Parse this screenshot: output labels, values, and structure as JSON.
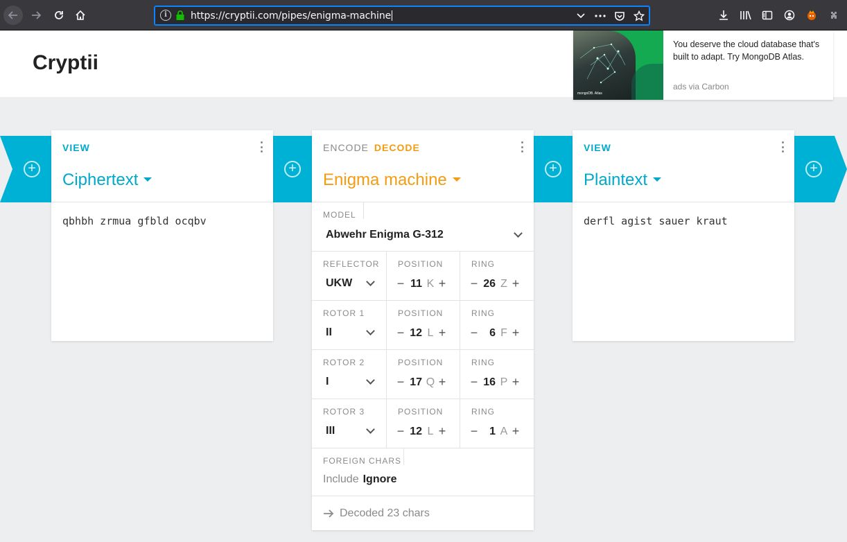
{
  "browser": {
    "url": "https://cryptii.com/pipes/enigma-machine"
  },
  "site": {
    "logo": "Cryptii"
  },
  "ad": {
    "text": "You deserve the cloud database that's built to adapt. Try MongoDB Atlas.",
    "via": "ads via Carbon",
    "image_caption": "mongoDB. Atlas"
  },
  "cards": {
    "left": {
      "mode": "VIEW",
      "title": "Ciphertext",
      "content": "qbhbh zrmua gfbld ocqbv"
    },
    "middle": {
      "mode_encode": "ENCODE",
      "mode_decode": "DECODE",
      "title": "Enigma machine",
      "model_label": "MODEL",
      "model_value": "Abwehr Enigma G-312",
      "rows": [
        {
          "label": "REFLECTOR",
          "value": "UKW",
          "position_label": "POSITION",
          "position": "11",
          "position_letter": "K",
          "ring_label": "RING",
          "ring": "26",
          "ring_letter": "Z"
        },
        {
          "label": "ROTOR 1",
          "value": "II",
          "position_label": "POSITION",
          "position": "12",
          "position_letter": "L",
          "ring_label": "RING",
          "ring": "6",
          "ring_letter": "F"
        },
        {
          "label": "ROTOR 2",
          "value": "I",
          "position_label": "POSITION",
          "position": "17",
          "position_letter": "Q",
          "ring_label": "RING",
          "ring": "16",
          "ring_letter": "P"
        },
        {
          "label": "ROTOR 3",
          "value": "III",
          "position_label": "POSITION",
          "position": "12",
          "position_letter": "L",
          "ring_label": "RING",
          "ring": "1",
          "ring_letter": "A"
        }
      ],
      "foreign_label": "FOREIGN CHARS",
      "foreign_include": "Include",
      "foreign_ignore": "Ignore",
      "status": "Decoded 23 chars"
    },
    "right": {
      "mode": "VIEW",
      "title": "Plaintext",
      "content": "derfl agist sauer kraut"
    }
  },
  "colors": {
    "accent": "#00b1d6",
    "decode": "#f39c12"
  }
}
